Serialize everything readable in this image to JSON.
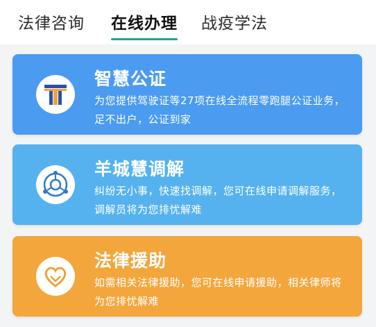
{
  "tabs": [
    {
      "label": "法律咨询",
      "active": false
    },
    {
      "label": "在线办理",
      "active": true
    },
    {
      "label": "战疫学法",
      "active": false
    }
  ],
  "cards": [
    {
      "title": "智慧公证",
      "description": "为您提供驾驶证等27项在线全流程零跑腿公证业务，足不出户，公证到家",
      "icon": "notary-logo-icon",
      "color": "#4b9bf0"
    },
    {
      "title": "羊城慧调解",
      "description": "纠纷无小事，快速找调解，您可在线申请调解服务，调解员将为您排忧解难",
      "icon": "mediation-logo-icon",
      "color": "#55b2ee"
    },
    {
      "title": "法律援助",
      "description": "如需相关法律援助，您可在线申请援助，相关律师将为您排忧解难",
      "icon": "legal-aid-heart-icon",
      "color": "#f3a63c"
    }
  ]
}
